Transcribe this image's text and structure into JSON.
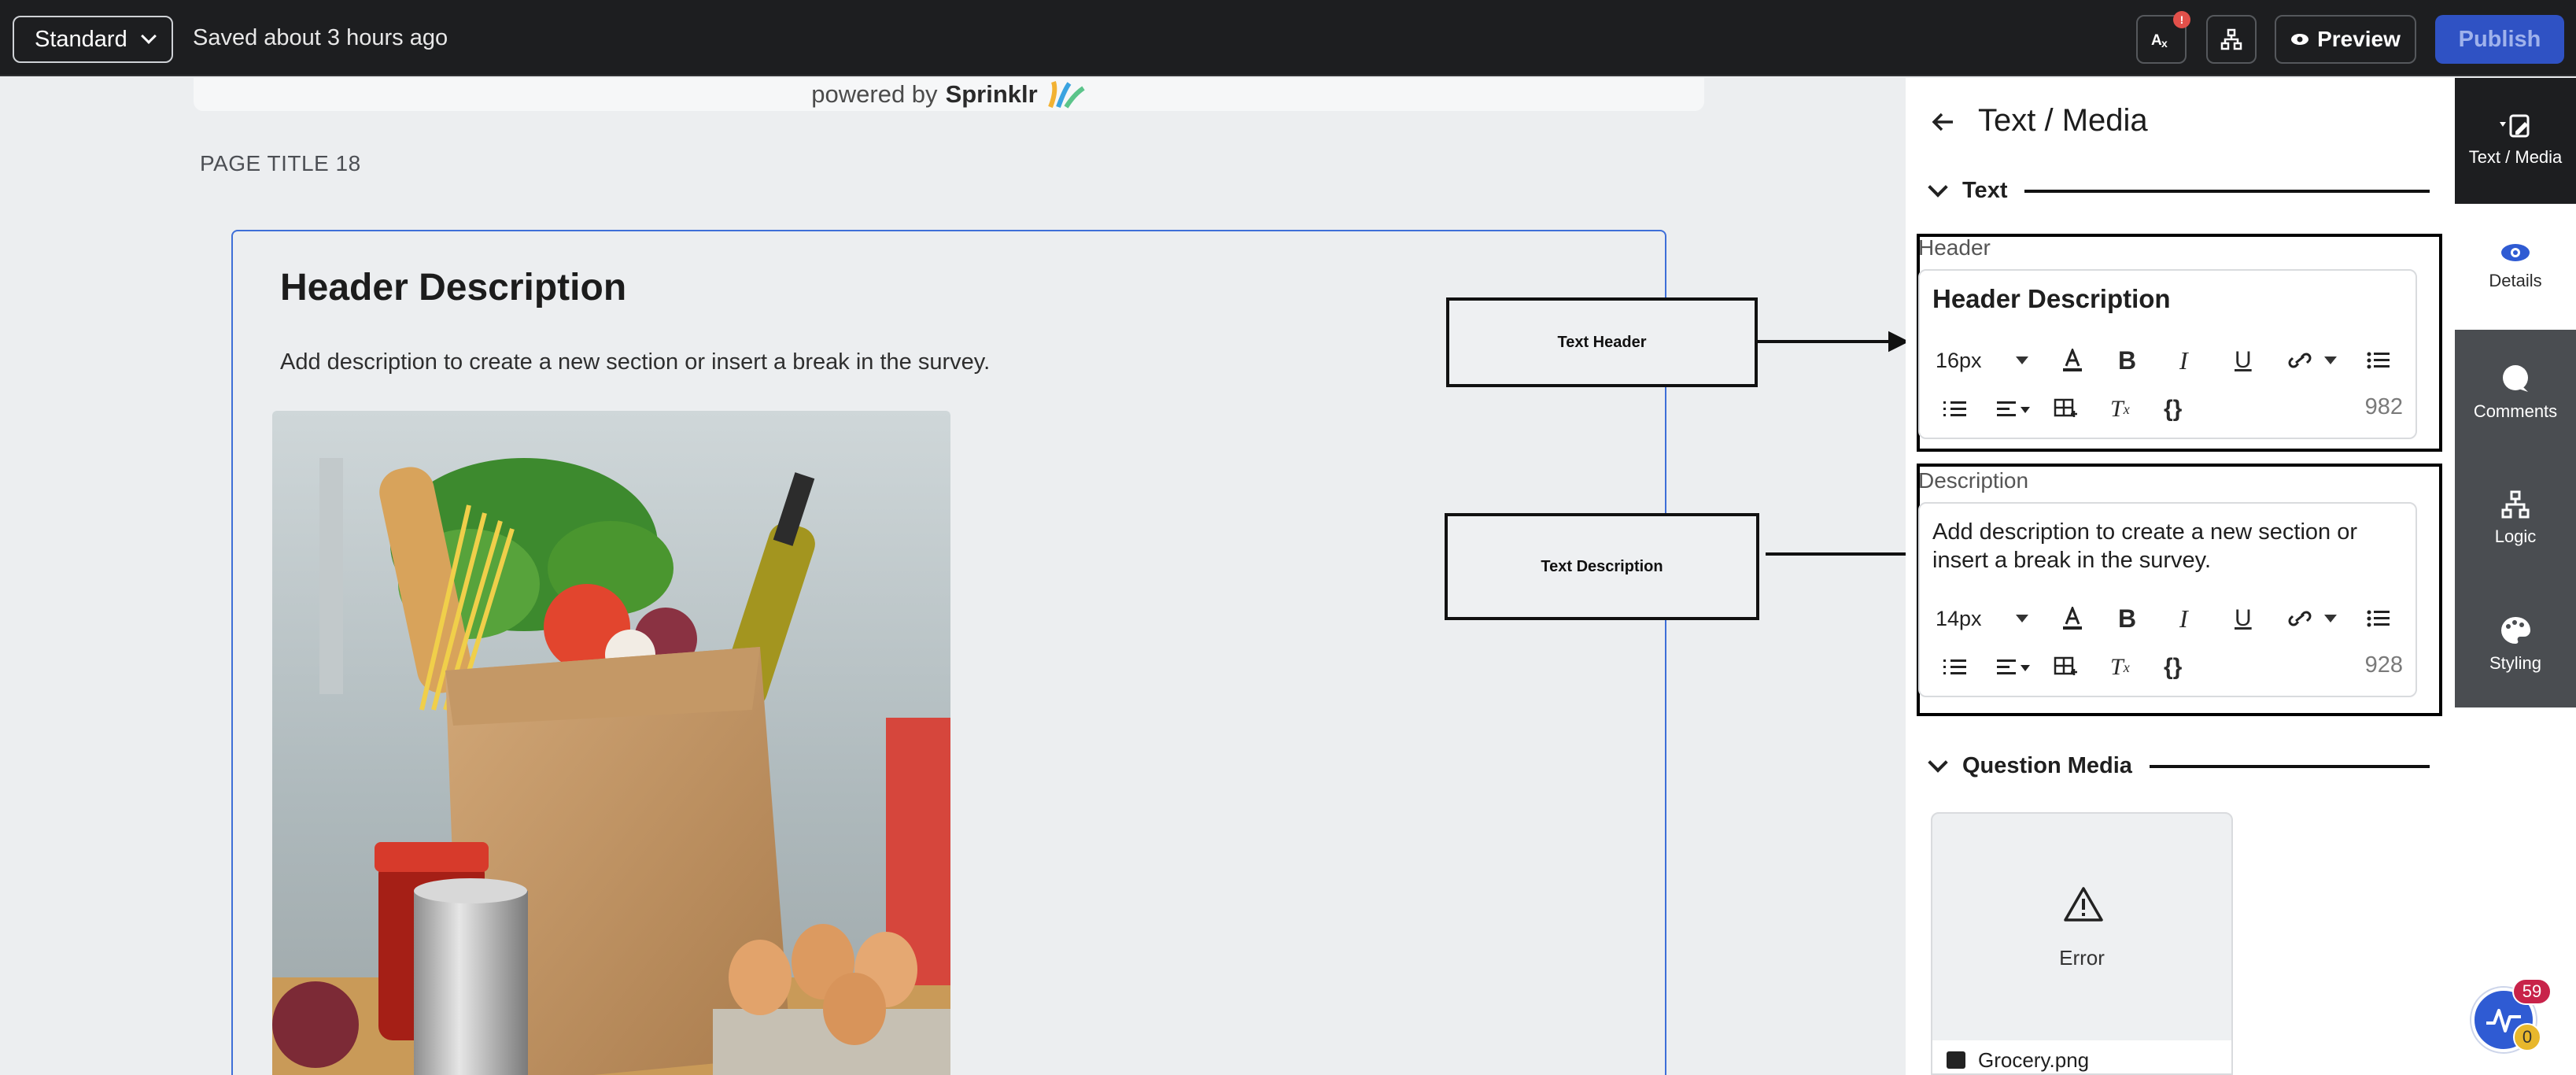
{
  "topbar": {
    "mode": "Standard",
    "saved_status": "Saved about 3 hours ago",
    "translate_badge": "!",
    "preview_label": "Preview",
    "publish_label": "Publish"
  },
  "canvas": {
    "powered_by_prefix": "powered by",
    "powered_by_brand": "Sprinklr",
    "page_title": "PAGE TITLE 18",
    "section_header": "Header Description",
    "section_description": "Add description to create a new section or insert a break in the survey.",
    "annotation_header": "Text Header",
    "annotation_description": "Text Description"
  },
  "panel": {
    "title": "Text / Media",
    "text_section": "Text",
    "header_label": "Header",
    "header_value": "Header Description",
    "header_font_size": "16px",
    "header_counter": "982",
    "description_label": "Description",
    "description_value": "Add description to create a new section or insert a break in the survey.",
    "description_font_size": "14px",
    "description_counter": "928",
    "media_section": "Question Media",
    "media_error": "Error",
    "media_filename": "Grocery.png"
  },
  "rnav": {
    "items": [
      {
        "label": "Text / Media",
        "icon": "edit-icon"
      },
      {
        "label": "Details",
        "icon": "eye-icon"
      },
      {
        "label": "Comments",
        "icon": "comment-icon"
      },
      {
        "label": "Logic",
        "icon": "tree-icon"
      },
      {
        "label": "Styling",
        "icon": "palette-icon"
      }
    ]
  },
  "fab": {
    "badge_count": "59",
    "secondary_count": "0"
  },
  "colors": {
    "topbar": "#1d1e20",
    "accent": "#2f52c4",
    "section_border": "#3e6fd8"
  }
}
